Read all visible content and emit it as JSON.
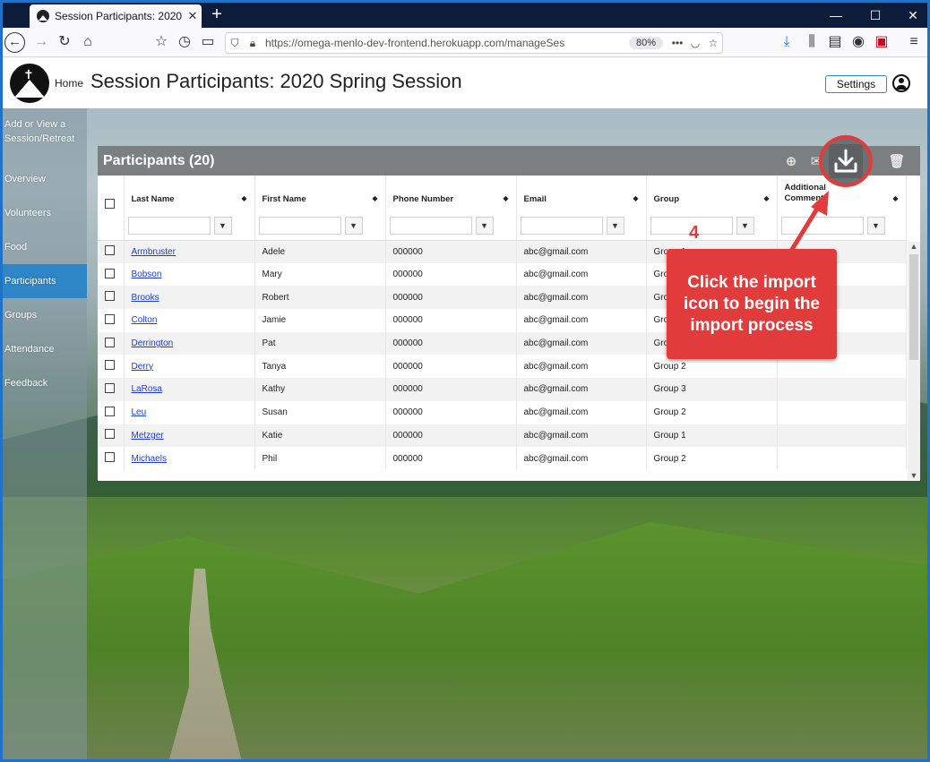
{
  "browser": {
    "tab_title": "Session Participants: 2020 Spring Session",
    "url": "https://omega-menlo-dev-frontend.herokuapp.com/manageSes",
    "zoom": "80%"
  },
  "header": {
    "home_label": "Home",
    "page_title": "Session Participants: 2020 Spring Session",
    "settings_label": "Settings"
  },
  "sidebar": {
    "items": [
      {
        "label": "Add or View a Session/Retreat"
      },
      {
        "label": "Overview"
      },
      {
        "label": "Volunteers"
      },
      {
        "label": "Food"
      },
      {
        "label": "Participants"
      },
      {
        "label": "Groups"
      },
      {
        "label": "Attendance"
      },
      {
        "label": "Feedback"
      }
    ]
  },
  "panel": {
    "title": "Participants (20)",
    "columns": [
      "Last Name",
      "First Name",
      "Phone Number",
      "Email",
      "Group",
      "Additional Comments"
    ],
    "rows": [
      [
        "Armbruster",
        "Adele",
        "000000",
        "abc@gmail.com",
        "Group 1",
        ""
      ],
      [
        "Bobson",
        "Mary",
        "000000",
        "abc@gmail.com",
        "Group 2",
        ""
      ],
      [
        "Brooks",
        "Robert",
        "000000",
        "abc@gmail.com",
        "Group 3",
        ""
      ],
      [
        "Colton",
        "Jamie",
        "000000",
        "abc@gmail.com",
        "Group 1",
        ""
      ],
      [
        "Derrington",
        "Pat",
        "000000",
        "abc@gmail.com",
        "Group 1",
        ""
      ],
      [
        "Derry",
        "Tanya",
        "000000",
        "abc@gmail.com",
        "Group 2",
        ""
      ],
      [
        "LaRosa",
        "Kathy",
        "000000",
        "abc@gmail.com",
        "Group 3",
        ""
      ],
      [
        "Leu",
        "Susan",
        "000000",
        "abc@gmail.com",
        "Group 2",
        ""
      ],
      [
        "Metzger",
        "Katie",
        "000000",
        "abc@gmail.com",
        "Group 1",
        ""
      ],
      [
        "Michaels",
        "Phil",
        "000000",
        "abc@gmail.com",
        "Group 2",
        ""
      ]
    ]
  },
  "annotation": {
    "step": "4",
    "callout": "Click the import icon to begin the import process",
    "accent_color": "#e23b3b"
  }
}
